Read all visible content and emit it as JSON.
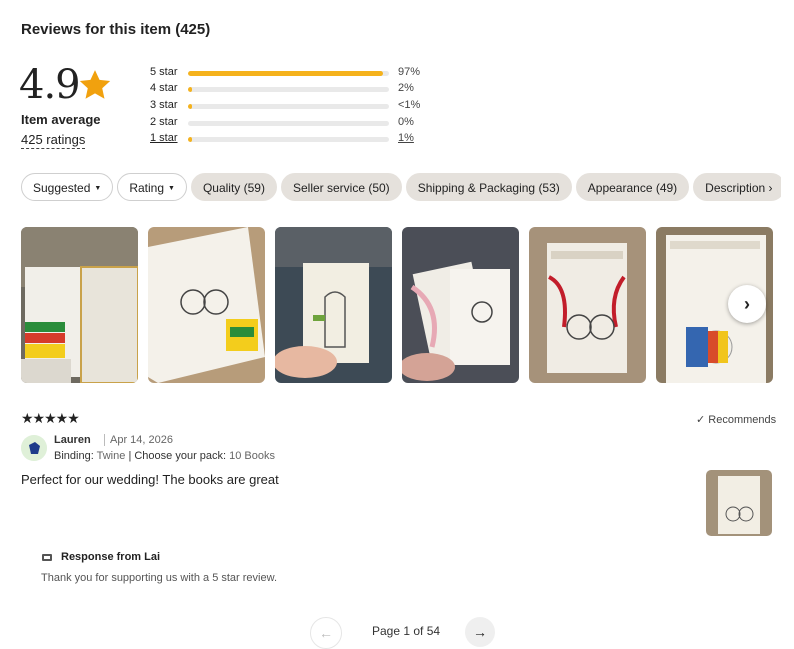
{
  "header": {
    "title": "Reviews for this item (425)"
  },
  "summary": {
    "average": "4.9",
    "average_label": "Item average",
    "ratings_count": "425 ratings",
    "star_color": "#f1a10e",
    "histogram": [
      {
        "label": "5 star",
        "pct": "97%",
        "fill_fraction": 0.97
      },
      {
        "label": "4 star",
        "pct": "2%",
        "fill_fraction": 0.02
      },
      {
        "label": "3 star",
        "pct": "<1%",
        "fill_fraction": 0.01
      },
      {
        "label": "2 star",
        "pct": "0%",
        "fill_fraction": 0.0
      },
      {
        "label": "1 star",
        "pct": "1%",
        "fill_fraction": 0.01
      }
    ]
  },
  "filters": {
    "sort": "Suggested",
    "rating": "Rating",
    "tags": [
      "Quality (59)",
      "Seller service (50)",
      "Shipping & Packaging (53)",
      "Appearance (49)",
      "Description"
    ]
  },
  "gallery": {
    "photos": [
      {
        "icon": "photo-crayons-box"
      },
      {
        "icon": "photo-couple-coloring-book"
      },
      {
        "icon": "photo-hand-holding-book"
      },
      {
        "icon": "photo-ribbon-books"
      },
      {
        "icon": "photo-wrapped-books"
      },
      {
        "icon": "photo-book-destiny-dylan"
      }
    ],
    "next_icon": "chevron-right-icon"
  },
  "review": {
    "stars": "★★★★★",
    "recommends": "✓ Recommends",
    "reviewer": "Lauren",
    "date": "Apr 14, 2026",
    "binding_label": "Binding:",
    "binding_value": "Twine",
    "pack_label": "Choose your pack:",
    "pack_value": "10 Books",
    "text": "Perfect for our wedding! The books are great",
    "response_title": "Response from Lai",
    "response_text": "Thank you for supporting us with a 5 star review."
  },
  "pagination": {
    "prev": "←",
    "label": "Page 1 of 54",
    "next": "→"
  }
}
